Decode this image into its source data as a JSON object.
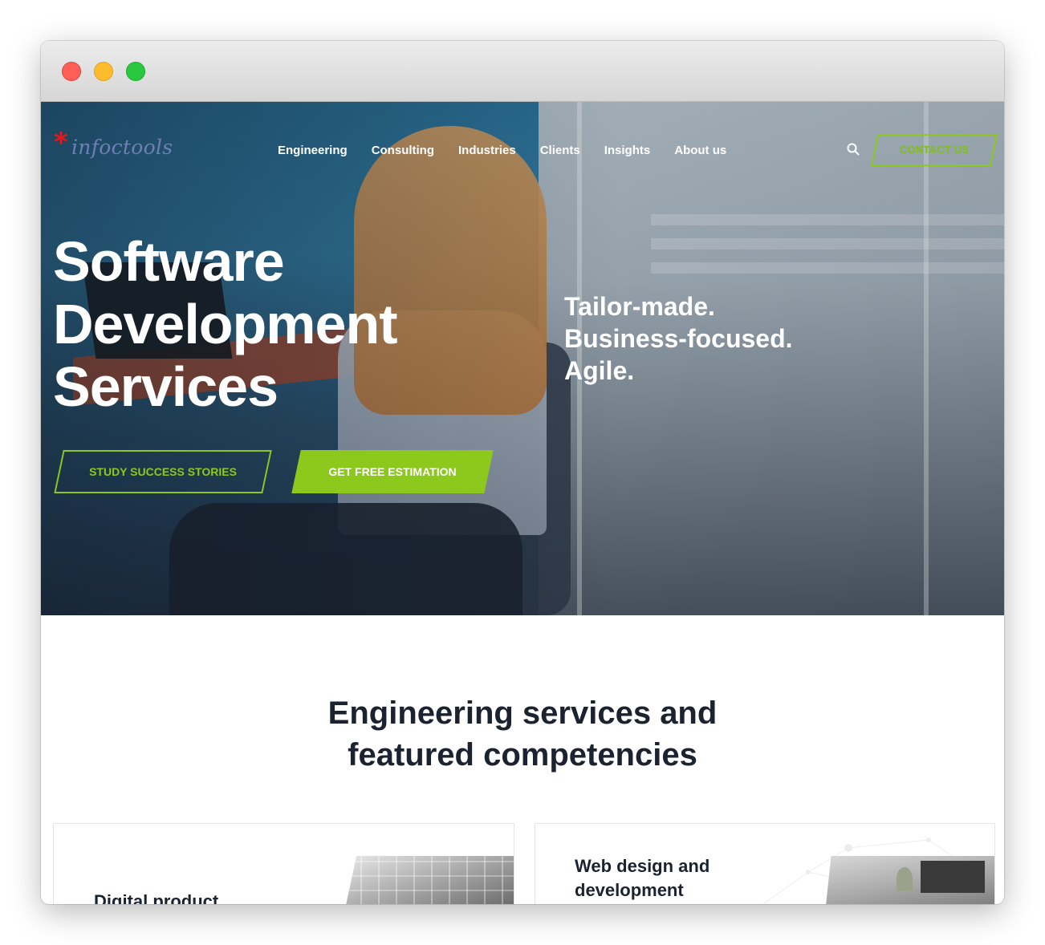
{
  "brand": {
    "logo_text": "infoctools",
    "logo_mark": "*",
    "accent": "#8dc81c",
    "logo_red": "#e8151b",
    "logo_blue": "#6f7fb4"
  },
  "nav": {
    "items": [
      "Engineering",
      "Consulting",
      "Industries",
      "Clients",
      "Insights",
      "About us"
    ],
    "search_icon": "search-icon",
    "contact_label": "CONTACT US"
  },
  "hero": {
    "title_lines": [
      "Software",
      "Development",
      "Services"
    ],
    "tagline_lines": [
      "Tailor-made.",
      "Business-focused.",
      "Agile."
    ],
    "primary_cta": "GET FREE ESTIMATION",
    "secondary_cta": "STUDY SUCCESS STORIES"
  },
  "section": {
    "title_lines": [
      "Engineering services and",
      "featured competencies"
    ]
  },
  "cards": [
    {
      "title_lines": [
        "Digital product"
      ]
    },
    {
      "title_lines": [
        "Web design and",
        "development"
      ]
    }
  ]
}
